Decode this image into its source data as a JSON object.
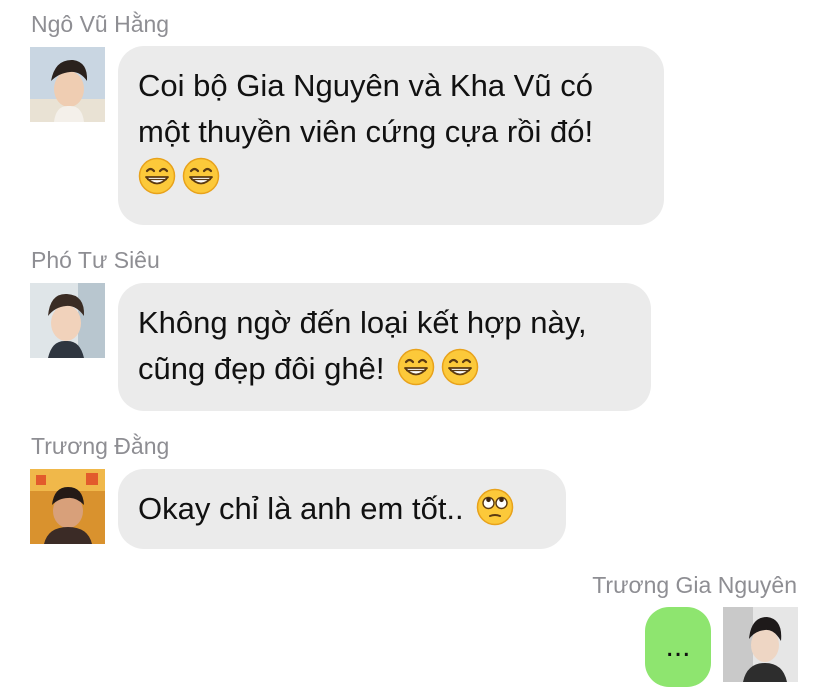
{
  "messages": [
    {
      "sender": "Ngô Vũ Hằng",
      "lines": [
        "Coi bộ Gia Nguyên và Kha Vũ có",
        "một thuyền viên cứng cựa rồi đó!"
      ],
      "emoji": [
        "grinning-face-with-smiling-eyes",
        "grinning-face-with-smiling-eyes"
      ]
    },
    {
      "sender": "Phó Tư Siêu",
      "lines": [
        "Không ngờ đến loại kết hợp này,",
        "cũng đẹp đôi ghê!"
      ],
      "emoji": [
        "grinning-face-with-smiling-eyes",
        "grinning-face-with-smiling-eyes"
      ]
    },
    {
      "sender": "Trương Đằng",
      "lines": [
        "Okay chỉ là anh em tốt.."
      ],
      "emoji": [
        "face-with-rolling-eyes"
      ]
    },
    {
      "sender": "Trương Gia Nguyên",
      "text": "...",
      "own": true
    }
  ],
  "colors": {
    "incoming_bubble": "#ebebeb",
    "outgoing_bubble": "#8ee56f",
    "sender_name": "#8e8e93",
    "message_text": "#111111"
  }
}
